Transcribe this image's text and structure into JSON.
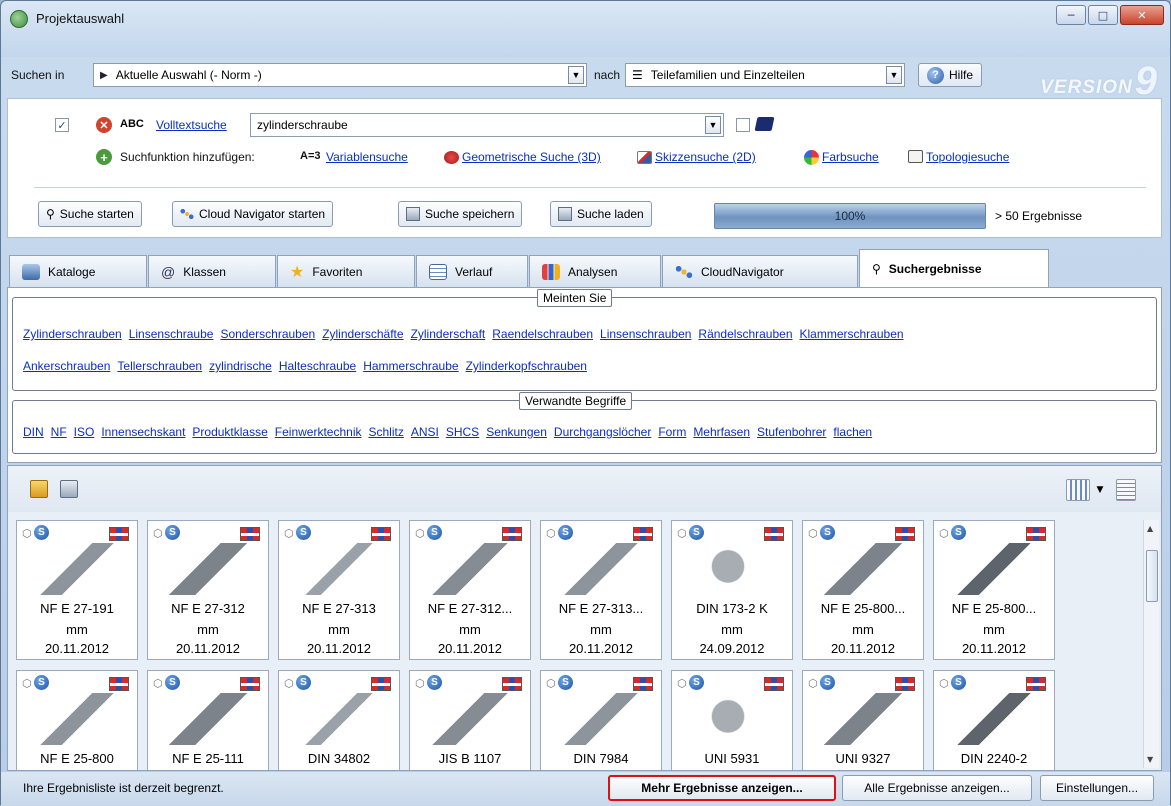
{
  "window": {
    "title": "Projektauswahl"
  },
  "search_row": {
    "search_in_label": "Suchen in",
    "search_in_value": "Aktuelle Auswahl (- Norm -)",
    "after_label": "nach",
    "after_value": "Teilefamilien und Einzelteilen",
    "help_label": "Hilfe",
    "version_text": "VERSION",
    "version_number": "9"
  },
  "search_panel": {
    "abc_label": "ABC",
    "fulltext_link": "Volltextsuche",
    "query": "zylinderschraube",
    "add_function_label": "Suchfunktion hinzufügen:",
    "var_prefix": "A=3",
    "functions": [
      "Variablensuche",
      "Geometrische Suche (3D)",
      "Skizzensuche (2D)",
      "Farbsuche",
      "Topologiesuche"
    ],
    "buttons": {
      "start": "Suche starten",
      "cloud": "Cloud Navigator starten",
      "save": "Suche speichern",
      "load": "Suche laden"
    },
    "progress_text": "100%",
    "results_count": "> 50 Ergebnisse"
  },
  "tabs": [
    {
      "label": "Kataloge"
    },
    {
      "label": "Klassen"
    },
    {
      "label": "Favoriten"
    },
    {
      "label": "Verlauf"
    },
    {
      "label": "Analysen"
    },
    {
      "label": "CloudNavigator"
    },
    {
      "label": "Suchergebnisse"
    }
  ],
  "suggestions": {
    "meant_title": "Meinten Sie",
    "meant_line1": [
      "Zylinderschrauben",
      "Linsenschraube",
      "Sonderschrauben",
      "Zylinderschäfte",
      "Zylinderschaft",
      "Raendelschrauben",
      "Linsenschrauben",
      "Rändelschrauben",
      "Klammerschrauben"
    ],
    "meant_line2": [
      "Ankerschrauben",
      "Tellerschrauben",
      "zylindrische",
      "Halteschraube",
      "Hammerschraube",
      "Zylinderkopfschrauben"
    ],
    "related_title": "Verwandte Begriffe",
    "related": [
      "DIN",
      "NF",
      "ISO",
      "Innensechskant",
      "Produktklasse",
      "Feinwerktechnik",
      "Schlitz",
      "ANSI",
      "SHCS",
      "Senkungen",
      "Durchgangslöcher",
      "Form",
      "Mehrfasen",
      "Stufenbohrer",
      "flachen"
    ]
  },
  "results": {
    "row1": [
      {
        "name": "NF E 27-191",
        "unit": "mm",
        "date": "20.11.2012"
      },
      {
        "name": "NF E 27-312",
        "unit": "mm",
        "date": "20.11.2012"
      },
      {
        "name": "NF E 27-313",
        "unit": "mm",
        "date": "20.11.2012"
      },
      {
        "name": "NF E 27-312...",
        "unit": "mm",
        "date": "20.11.2012"
      },
      {
        "name": "NF E 27-313...",
        "unit": "mm",
        "date": "20.11.2012"
      },
      {
        "name": "DIN 173-2 K",
        "unit": "mm",
        "date": "24.09.2012"
      },
      {
        "name": "NF E 25-800...",
        "unit": "mm",
        "date": "20.11.2012"
      },
      {
        "name": "NF E 25-800...",
        "unit": "mm",
        "date": "20.11.2012"
      }
    ],
    "row2": [
      {
        "name": "NF E 25-800"
      },
      {
        "name": "NF E 25-111"
      },
      {
        "name": "DIN 34802"
      },
      {
        "name": "JIS B 1107"
      },
      {
        "name": "DIN 7984"
      },
      {
        "name": "UNI 5931"
      },
      {
        "name": "UNI 9327"
      },
      {
        "name": "DIN 2240-2"
      }
    ]
  },
  "footer": {
    "status": "Ihre Ergebnisliste ist derzeit begrenzt.",
    "more": "Mehr Ergebnisse anzeigen...",
    "all": "Alle Ergebnisse anzeigen...",
    "settings": "Einstellungen..."
  }
}
